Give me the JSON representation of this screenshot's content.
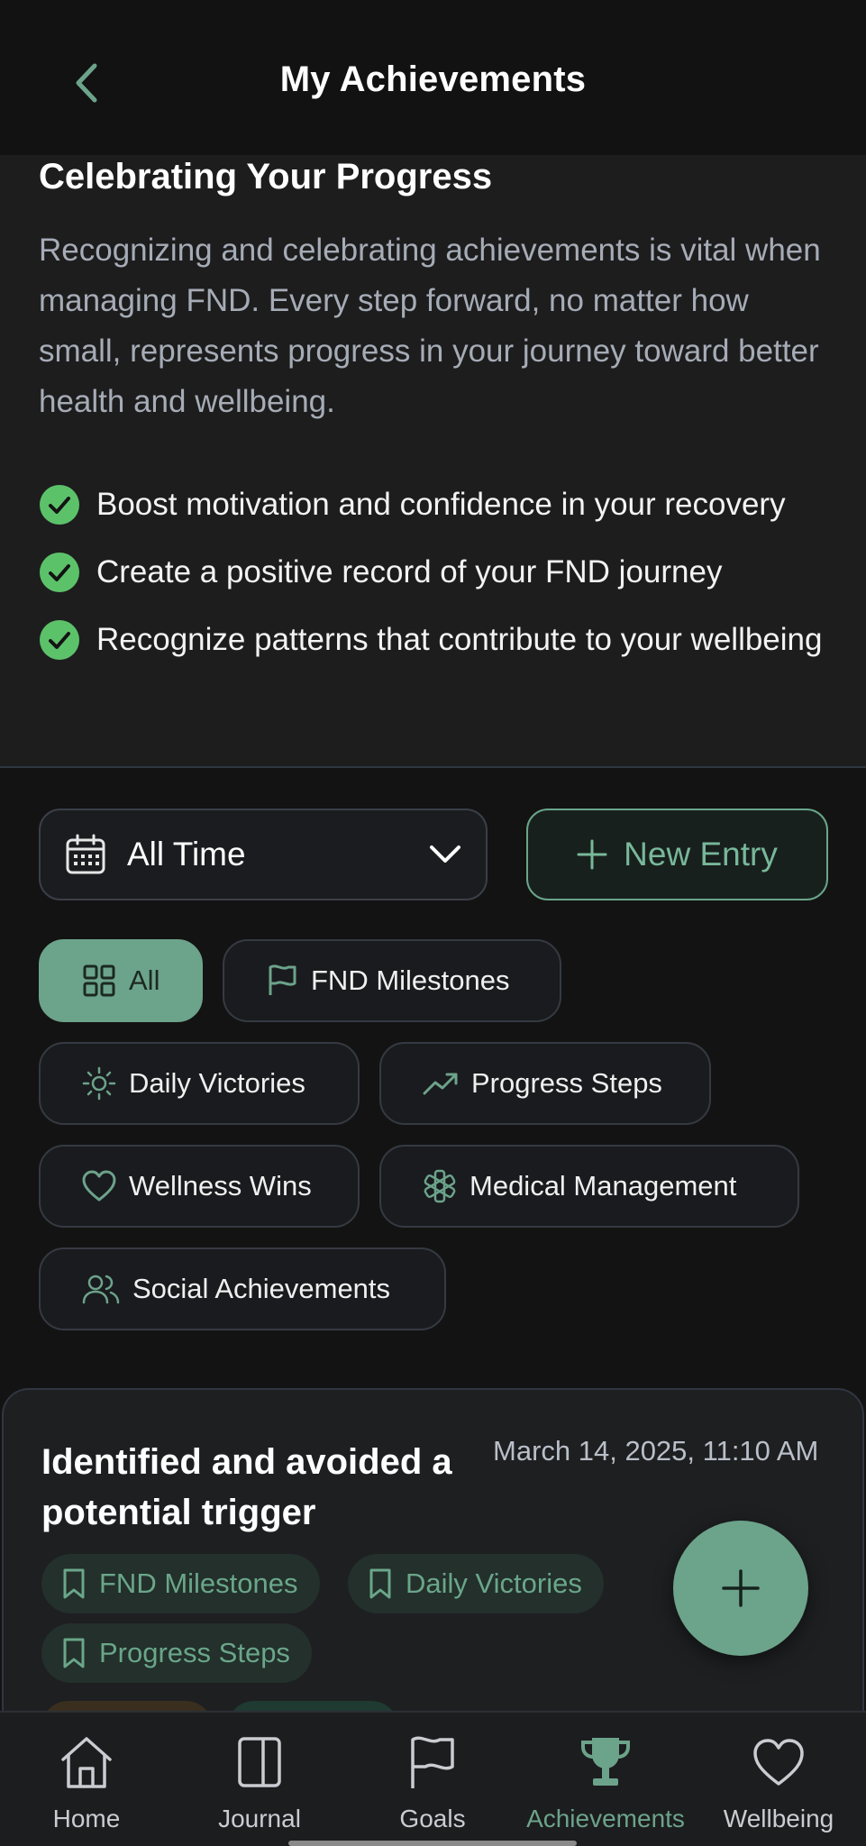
{
  "header": {
    "title": "My Achievements"
  },
  "intro": {
    "heading": "Celebrating Your Progress",
    "text": "Recognizing and celebrating achievements is vital when managing FND. Every step forward, no matter how small, represents progress in your journey toward better health and wellbeing.",
    "benefits": [
      "Boost motivation and confidence in your recovery",
      "Create a positive record of your FND journey",
      "Recognize patterns that contribute to your wellbeing"
    ]
  },
  "filters": {
    "time_range": "All Time",
    "new_entry_label": "New Entry",
    "categories": [
      "All",
      "FND Milestones",
      "Daily Victories",
      "Progress Steps",
      "Wellness Wins",
      "Medical Management",
      "Social Achievements"
    ]
  },
  "entry": {
    "title": "Identified and avoided a potential trigger",
    "date": "March 14, 2025, 11:10 AM",
    "tags": [
      "FND Milestones",
      "Daily Victories",
      "Progress Steps"
    ]
  },
  "nav": {
    "items": [
      "Home",
      "Journal",
      "Goals",
      "Achievements",
      "Wellbeing"
    ],
    "active": "Achievements"
  },
  "colors": {
    "accent": "#6ca38b",
    "check": "#5cc26a",
    "background": "#131313",
    "card": "#1e1f21"
  }
}
